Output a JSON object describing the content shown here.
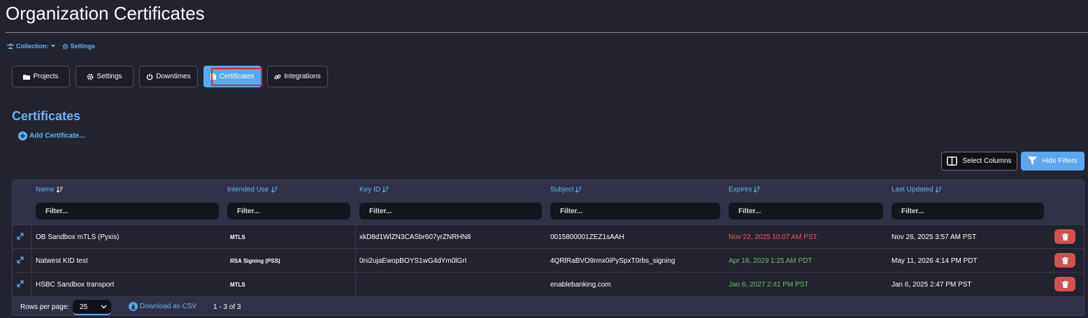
{
  "page": {
    "title": "Organization Certificates"
  },
  "toplinks": {
    "collection_label": "Collection:",
    "settings_label": "Settings"
  },
  "tabs": [
    {
      "label": "Projects",
      "icon": "folder-icon"
    },
    {
      "label": "Settings",
      "icon": "gear-icon"
    },
    {
      "label": "Downtimes",
      "icon": "power-icon"
    },
    {
      "label": "Certificates",
      "icon": "certificate-icon",
      "active": true
    },
    {
      "label": "Integrations",
      "icon": "link-icon"
    }
  ],
  "section": {
    "title": "Certificates",
    "add_label": "Add Certificate..."
  },
  "toolbar": {
    "select_columns_label": "Select Columns",
    "hide_filters_label": "Hide Filters"
  },
  "table": {
    "columns": [
      {
        "label": "Name",
        "sort": "sorted"
      },
      {
        "label": "Intended Use",
        "sort": "sortable"
      },
      {
        "label": "Key ID",
        "sort": "sortable"
      },
      {
        "label": "Subject",
        "sort": "sortable"
      },
      {
        "label": "Expires",
        "sort": "sortable"
      },
      {
        "label": "Last Updated",
        "sort": "sortable"
      }
    ],
    "filter_placeholder": "Filter...",
    "rows": [
      {
        "name": "OB Sandbox mTLS (Pyxis)",
        "intended_use": "MTLS",
        "key_id": "xkD8d1WlZN3CASbr607yrZNRHN8",
        "subject": "0015800001ZEZ1sAAH",
        "expires": "Nov 22, 2025 10:07 AM PST",
        "expires_status": "expired",
        "last_updated": "Nov 26, 2025 3:57 AM PST"
      },
      {
        "name": "Natwest KID test",
        "intended_use": "RSA Signing (PSS)",
        "key_id": "0ni2ujaEwopBOYS1wG4dYm0lGrI",
        "subject": "4QRlRaBVO9rmx0iPySpxT0rbs_signing",
        "expires": "Apr 16, 2029 1:25 AM PDT",
        "expires_status": "valid",
        "last_updated": "May 11, 2026 4:14 PM PDT"
      },
      {
        "name": "HSBC Sandbox transport",
        "intended_use": "MTLS",
        "key_id": "",
        "subject": "enablebanking.com",
        "expires": "Jan 6, 2027 2:41 PM PST",
        "expires_status": "valid",
        "last_updated": "Jan 6, 2025 2:47 PM PST"
      }
    ],
    "footer": {
      "rows_per_page_label": "Rows per page:",
      "rows_per_page_value": "25",
      "download_label": "Download as CSV",
      "range_label": "1 - 3 of 3"
    }
  },
  "colors": {
    "background": "#22232f",
    "accent": "#5aa8ef",
    "link": "#6ab4f0",
    "expired": "#e0605a",
    "valid": "#6cc06a",
    "danger": "#d0524e",
    "highlight_box": "#e0242a"
  }
}
